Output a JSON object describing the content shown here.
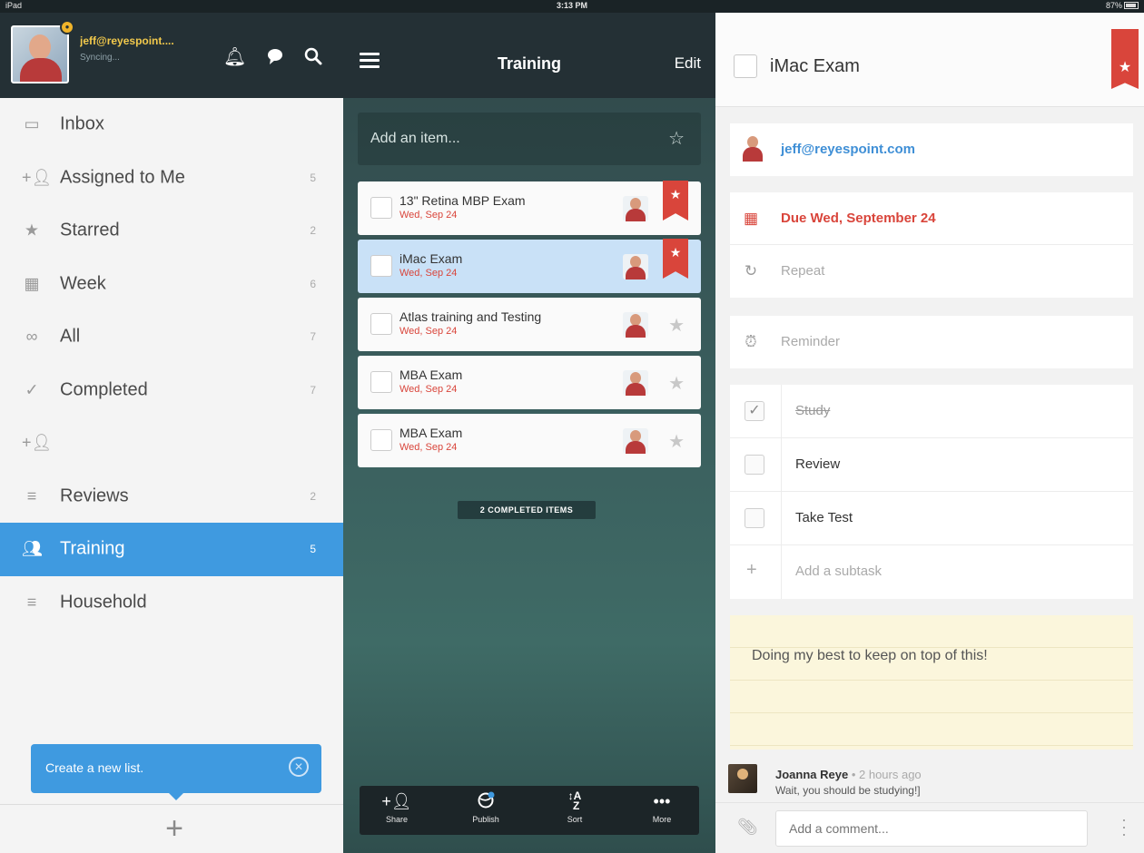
{
  "status_bar": {
    "device": "iPad",
    "time": "3:13 PM",
    "battery": "87%"
  },
  "sidebar": {
    "user": {
      "name": "jeff@reyespoint....",
      "status": "Syncing..."
    },
    "items": [
      {
        "label": "Inbox",
        "count": "",
        "icon": "inbox-icon"
      },
      {
        "label": "Assigned to Me",
        "count": "5",
        "icon": "assigned-icon"
      },
      {
        "label": "Starred",
        "count": "2",
        "icon": "star-icon"
      },
      {
        "label": "Week",
        "count": "6",
        "icon": "calendar-icon"
      },
      {
        "label": "All",
        "count": "7",
        "icon": "infinity-icon"
      },
      {
        "label": "Completed",
        "count": "7",
        "icon": "checkmark-icon"
      },
      {
        "label": "",
        "count": "",
        "icon": "add-person-icon"
      },
      {
        "label": "Reviews",
        "count": "2",
        "icon": "list-icon"
      },
      {
        "label": "Training",
        "count": "5",
        "icon": "shared-list-icon",
        "active": true
      },
      {
        "label": "Household",
        "count": "",
        "icon": "list-icon"
      }
    ],
    "tooltip": "Create a new list."
  },
  "list": {
    "title": "Training",
    "edit_label": "Edit",
    "add_item_placeholder": "Add an item...",
    "tasks": [
      {
        "title": "13\" Retina MBP Exam",
        "date": "Wed, Sep 24",
        "starred": true,
        "selected": false
      },
      {
        "title": "iMac Exam",
        "date": "Wed, Sep 24",
        "starred": true,
        "selected": true
      },
      {
        "title": "Atlas training and Testing",
        "date": "Wed, Sep 24",
        "starred": false,
        "selected": false
      },
      {
        "title": "MBA Exam",
        "date": "Wed, Sep 24",
        "starred": false,
        "selected": false
      },
      {
        "title": "MBA Exam",
        "date": "Wed, Sep 24",
        "starred": false,
        "selected": false
      }
    ],
    "completed_label": "2 COMPLETED ITEMS",
    "toolbar": [
      {
        "label": "Share",
        "icon": "share-icon"
      },
      {
        "label": "Publish",
        "icon": "publish-icon"
      },
      {
        "label": "Sort",
        "icon": "sort-icon"
      },
      {
        "label": "More",
        "icon": "more-icon"
      }
    ]
  },
  "detail": {
    "title": "iMac Exam",
    "assignee": "jeff@reyespoint.com",
    "due": "Due Wed, September 24",
    "repeat": "Repeat",
    "reminder": "Reminder",
    "subtasks": [
      {
        "label": "Study",
        "done": true
      },
      {
        "label": "Review",
        "done": false
      },
      {
        "label": "Take Test",
        "done": false
      }
    ],
    "add_subtask": "Add a subtask",
    "note": "Doing my best to keep on top of this!",
    "comment": {
      "author": "Joanna Reye",
      "time": "• 2 hours ago",
      "body": "Wait, you should be studying!]"
    },
    "comment_placeholder": "Add a comment..."
  },
  "colors": {
    "accent": "#3f9ae0",
    "due_red": "#d9453b",
    "header_dark": "#243035"
  }
}
